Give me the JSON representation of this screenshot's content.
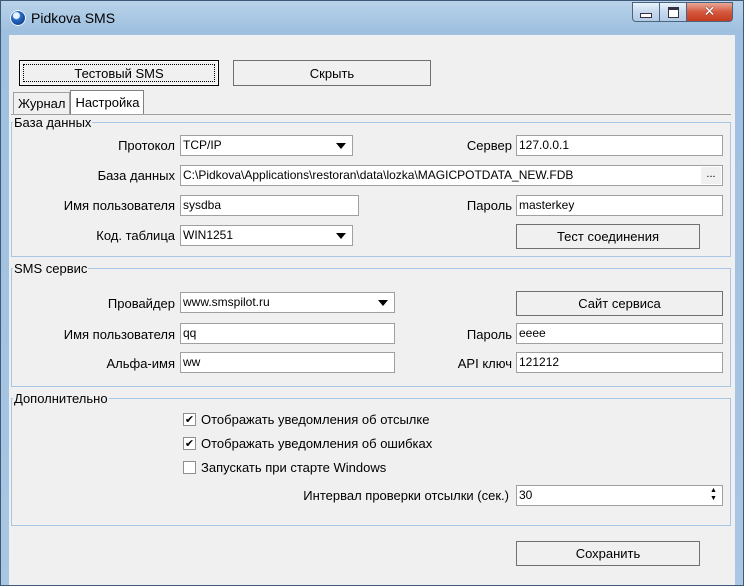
{
  "window": {
    "title": "Pidkova SMS"
  },
  "toolbar": {
    "test_sms_label": "Тестовый SMS",
    "hide_label": "Скрыть"
  },
  "tabs": [
    {
      "label": "Журнал"
    },
    {
      "label": "Настройка"
    }
  ],
  "database": {
    "legend": "База данных",
    "protocol_label": "Протокол",
    "protocol_value": "TCP/IP",
    "server_label": "Сервер",
    "server_value": "127.0.0.1",
    "db_label": "База данных",
    "db_value": "C:\\Pidkova\\Applications\\restoran\\data\\lozka\\MAGICPOTDATA_NEW.FDB",
    "browse_label": "...",
    "user_label": "Имя пользователя",
    "user_value": "sysdba",
    "password_label": "Пароль",
    "password_value": "masterkey",
    "codetable_label": "Код. таблица",
    "codetable_value": "WIN1251",
    "test_button": "Тест соединения"
  },
  "sms": {
    "legend": "SMS сервис",
    "provider_label": "Провайдер",
    "provider_value": "www.smspilot.ru",
    "site_button": "Сайт сервиса",
    "user_label": "Имя пользователя",
    "user_value": "qq",
    "password_label": "Пароль",
    "password_value": "eeee",
    "alpha_label": "Альфа-имя",
    "alpha_value": "ww",
    "apikey_label": "API ключ",
    "apikey_value": "121212"
  },
  "extra": {
    "legend": "Дополнительно",
    "opt1": "Отображать уведомления об отсылке",
    "opt2": "Отображать уведомления об ошибках",
    "opt3": "Запускать при старте Windows",
    "interval_label": "Интервал проверки отсылки (сек.)",
    "interval_value": "30"
  },
  "save_button": "Сохранить"
}
